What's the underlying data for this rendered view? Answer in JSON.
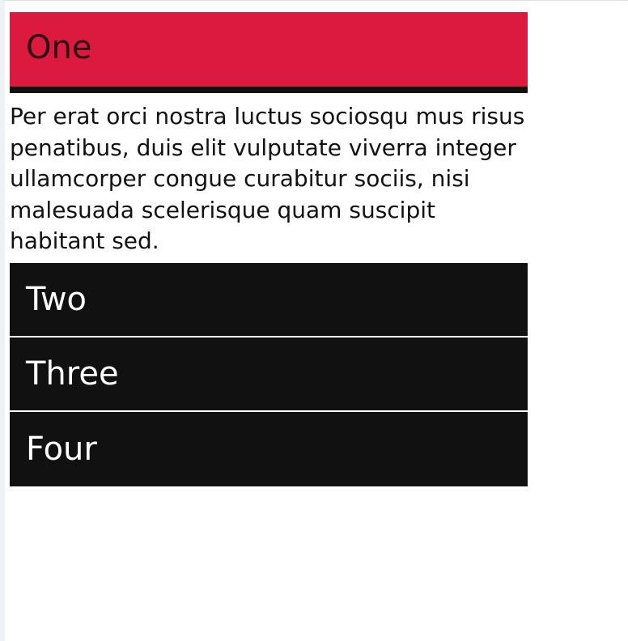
{
  "accordion": {
    "sections": [
      {
        "title": "One",
        "expanded": true,
        "body": "Per erat orci nostra luctus sociosqu mus risus penatibus, duis elit vulputate viverra integer ullamcorper congue curabitur sociis, nisi malesuada scelerisque quam suscipit habitant sed."
      },
      {
        "title": "Two",
        "expanded": false
      },
      {
        "title": "Three",
        "expanded": false
      },
      {
        "title": "Four",
        "expanded": false
      }
    ]
  },
  "colors": {
    "active_header": "#dc1a3f",
    "inactive_header": "#111111",
    "header_text": "#ffffff"
  }
}
